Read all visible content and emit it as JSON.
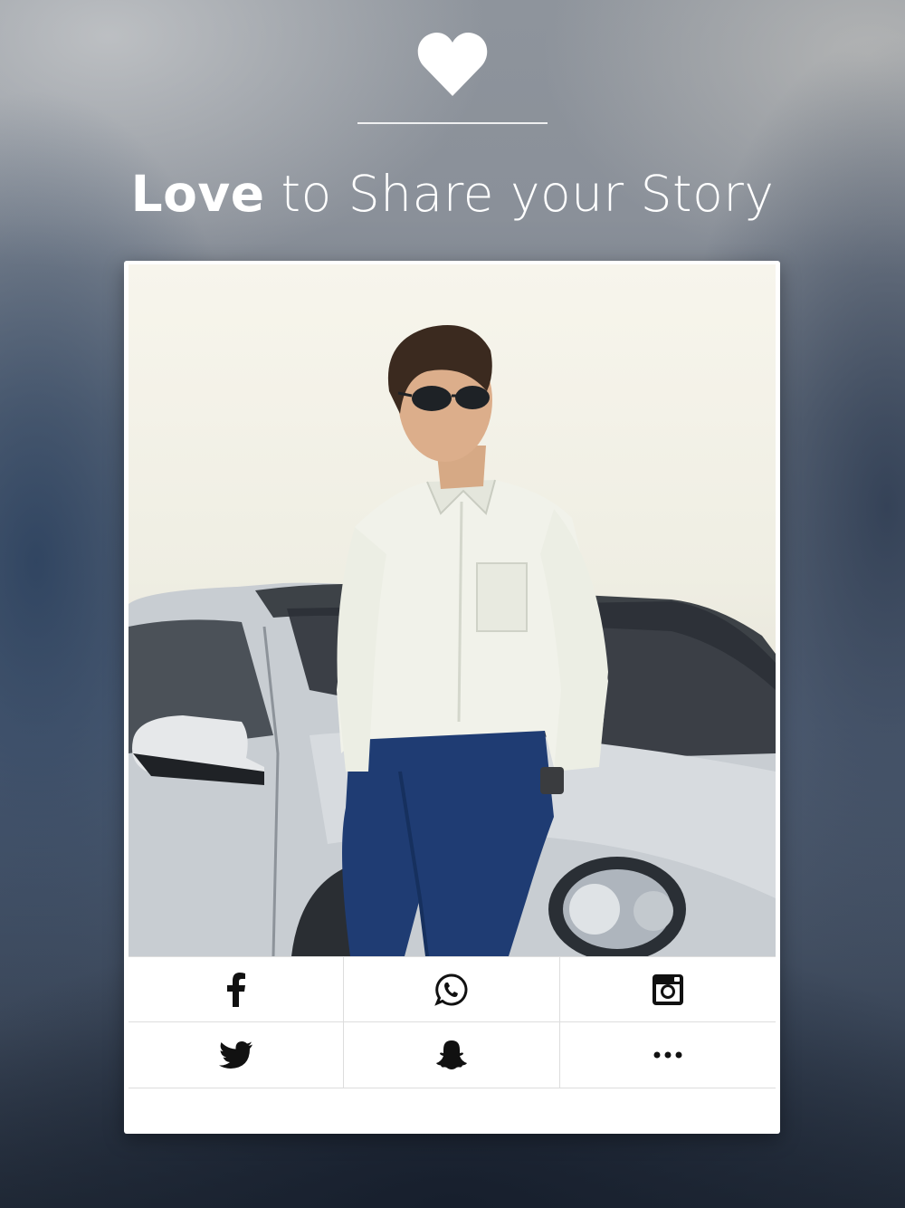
{
  "header": {
    "icon": "heart-icon",
    "title_strong": "Love",
    "title_rest": " to Share your Story"
  },
  "photo": {
    "description_icon": "photo"
  },
  "share": {
    "buttons": [
      {
        "icon": "facebook-icon"
      },
      {
        "icon": "whatsapp-icon"
      },
      {
        "icon": "instagram-icon"
      },
      {
        "icon": "twitter-icon"
      },
      {
        "icon": "snapchat-icon"
      },
      {
        "icon": "more-icon"
      }
    ]
  },
  "colors": {
    "text": "#ffffff",
    "card": "#ffffff",
    "icon": "#111111",
    "grid_line": "#dddddd"
  }
}
